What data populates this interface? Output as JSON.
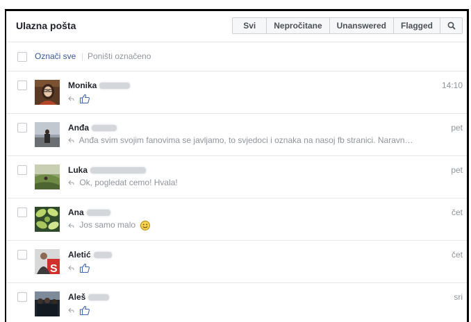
{
  "header": {
    "title": "Ulazna pošta",
    "filters": [
      "Svi",
      "Nepročitane",
      "Unanswered",
      "Flagged"
    ],
    "search_icon": "search-icon"
  },
  "selection": {
    "select_all": "Označi sve",
    "deselect": "Poništi označeno"
  },
  "messages": [
    {
      "name": "Monika",
      "snippet": "",
      "snippet_icon": "like-icon",
      "time": "14:10"
    },
    {
      "name": "Anđa",
      "snippet": "Anđa svim svojim fanovima se javljamo, to svjedoci i oznaka na nasoj fb stranici. Naravn…",
      "time": "pet"
    },
    {
      "name": "Luka",
      "snippet": "Ok, pogledat cemo! Hvala!",
      "time": "pet"
    },
    {
      "name": "Ana",
      "snippet": "Jos samo malo",
      "snippet_icon": "smiley-emoji-icon",
      "time": "čet"
    },
    {
      "name": "Aletić",
      "snippet": "",
      "snippet_icon": "like-icon",
      "time": "čet"
    },
    {
      "name": "Aleš",
      "snippet": "",
      "snippet_icon": "like-icon",
      "time": "sri"
    }
  ],
  "colors": {
    "link": "#365899",
    "muted": "#90949c",
    "border": "#e5e5e5",
    "like": "#4267b2"
  }
}
